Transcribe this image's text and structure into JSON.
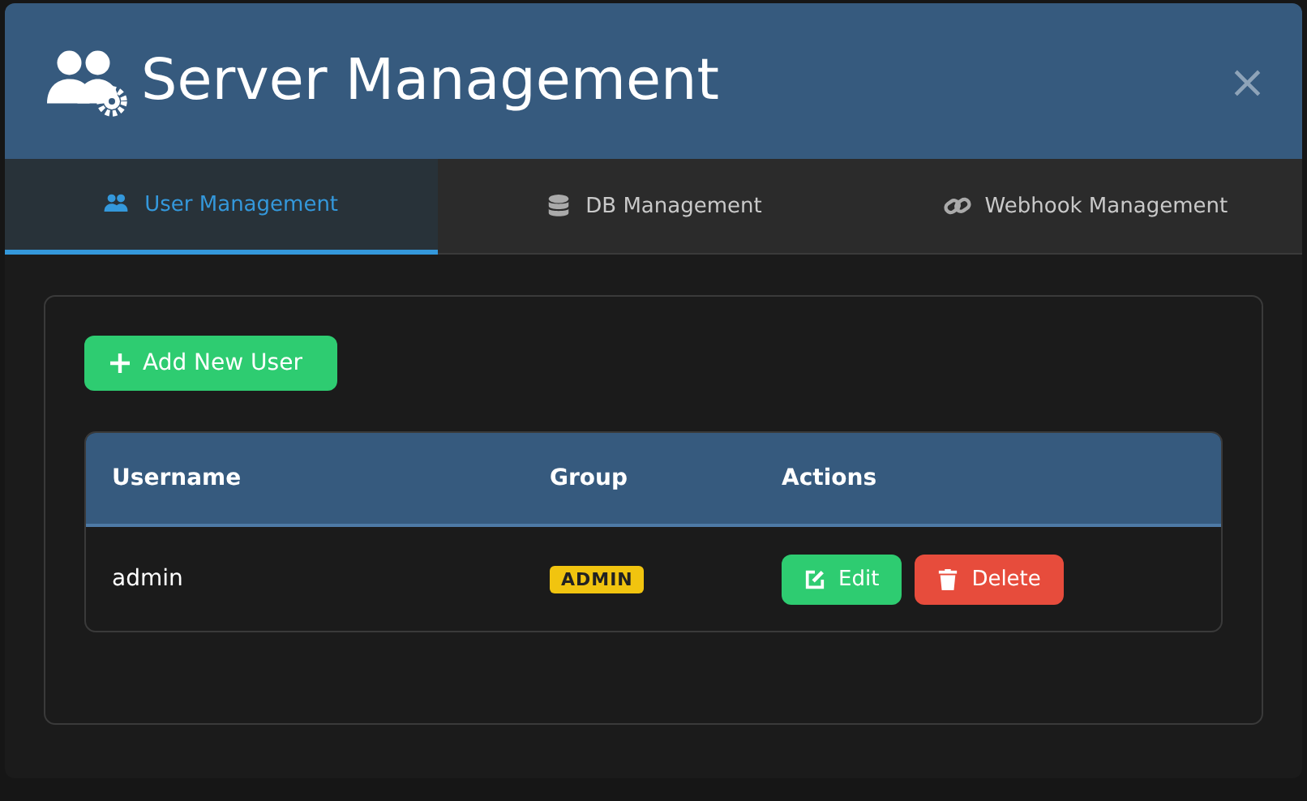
{
  "window": {
    "title": "Server Management",
    "close": "×"
  },
  "tabs": [
    {
      "label": "User Management",
      "selected": true
    },
    {
      "label": "DB Management",
      "selected": false
    },
    {
      "label": "Webhook Management",
      "selected": false
    }
  ],
  "add_button": "Add New User",
  "table": {
    "columns": [
      "Username",
      "Group",
      "Actions"
    ],
    "rows": [
      {
        "username": "admin",
        "group": "ADMIN",
        "actions": [
          {
            "kind": "edit",
            "label": "Edit"
          },
          {
            "kind": "delete",
            "label": "Delete"
          }
        ]
      }
    ]
  }
}
